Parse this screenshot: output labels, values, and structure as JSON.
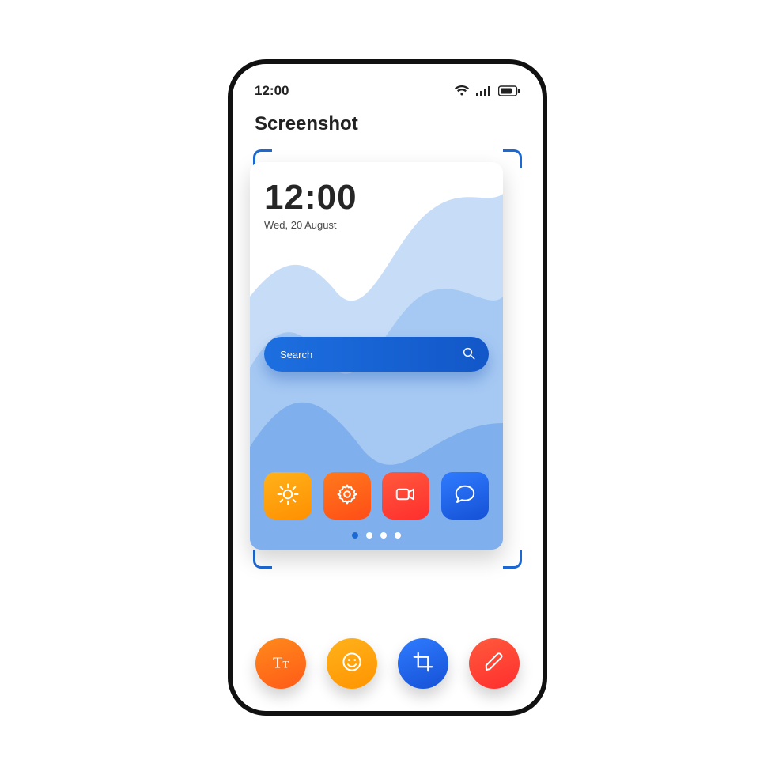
{
  "status": {
    "time": "12:00"
  },
  "title": "Screenshot",
  "preview": {
    "clock": "12:00",
    "date": "Wed, 20 August",
    "search_placeholder": "Search",
    "apps": [
      {
        "name": "weather-icon",
        "color_a": "#ffb21b",
        "color_b": "#ff8f00"
      },
      {
        "name": "settings-icon",
        "color_a": "#ff7a1c",
        "color_b": "#ff4d17"
      },
      {
        "name": "video-icon",
        "color_a": "#ff5a3c",
        "color_b": "#ff2e2e"
      },
      {
        "name": "chat-icon",
        "color_a": "#2f7bff",
        "color_b": "#1551d6"
      }
    ],
    "page_count": 4,
    "active_page": 0
  },
  "tools": [
    {
      "name": "text-tool",
      "color_a": "#ff8a1c",
      "color_b": "#ff5a17"
    },
    {
      "name": "emoji-tool",
      "color_a": "#ffb21b",
      "color_b": "#ff9400"
    },
    {
      "name": "crop-tool",
      "color_a": "#2f7bff",
      "color_b": "#1551d6"
    },
    {
      "name": "draw-tool",
      "color_a": "#ff5a3c",
      "color_b": "#ff2e2e"
    }
  ],
  "colors": {
    "accent_blue": "#1d69d4",
    "mountain_light": "#c7ddf7",
    "mountain_mid": "#a6c9f3",
    "mountain_dark": "#7fb0ed"
  }
}
